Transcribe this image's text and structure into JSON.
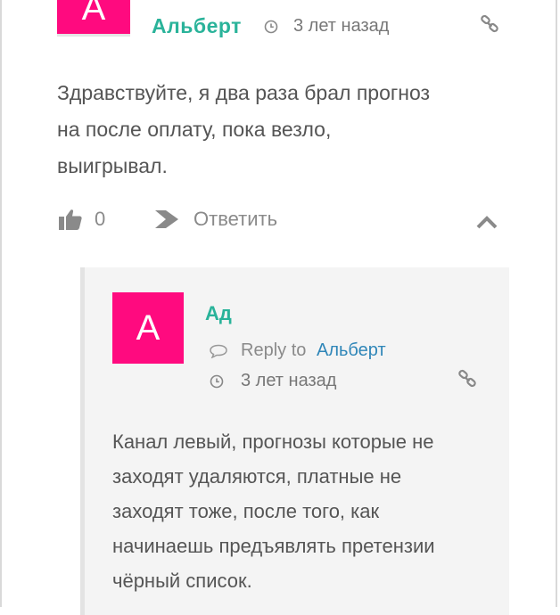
{
  "top_comment": {
    "avatar_letter": "A",
    "author": "Альберт",
    "time": "3 лет назад",
    "body_lines": [
      "Здравствуйте, я два раза брал прогноз",
      "на после оплату, пока везло,",
      "выигрывал."
    ],
    "like_count": "0",
    "reply_label": "Ответить"
  },
  "reply_comment": {
    "avatar_letter": "A",
    "author": "Ад",
    "reply_to_label": "Reply to",
    "reply_to_name": "Альберт",
    "time": "3 лет назад",
    "body_lines": [
      "Канал левый, прогнозы которые не",
      "заходят удаляются, платные не",
      "заходят тоже, после того, как",
      "начинаешь предъявлять претензии",
      "чёрный список."
    ]
  },
  "colors": {
    "avatar": "#ff0a7f",
    "author": "#2ab39a",
    "link": "#2f86b8",
    "muted": "#8a8a8a"
  },
  "icons": [
    "clock-icon",
    "link-icon",
    "thumbs-up-icon",
    "reply-arrow-icon",
    "chevron-up-icon",
    "speech-bubble-icon"
  ]
}
